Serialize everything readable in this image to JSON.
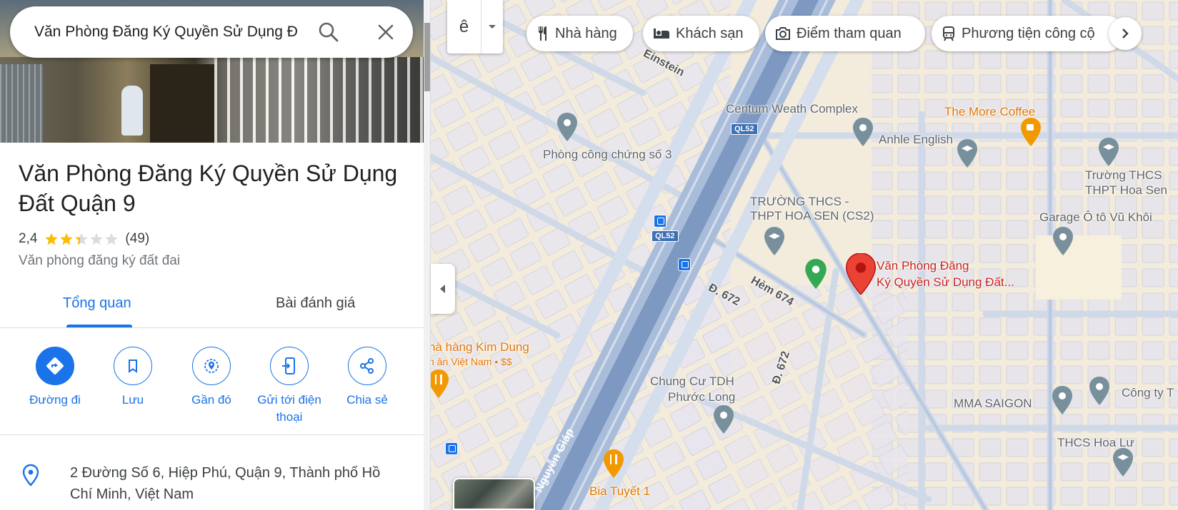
{
  "search": {
    "value": "Văn Phòng Đăng Ký Quyền Sử Dụng Đ"
  },
  "place": {
    "title": "Văn Phòng Đăng Ký Quyền Sử Dụng Đất Quận 9",
    "rating": "2,4",
    "rating_value": 2.4,
    "review_count": "(49)",
    "category": "Văn phòng đăng ký đất đai",
    "address": "2 Đường Số 6, Hiệp Phú, Quận 9, Thành phố Hồ Chí Minh, Việt Nam"
  },
  "tabs": [
    {
      "label": "Tổng quan",
      "active": true
    },
    {
      "label": "Bài đánh giá",
      "active": false
    }
  ],
  "actions": [
    {
      "label": "Đường đi",
      "icon": "directions-icon"
    },
    {
      "label": "Lưu",
      "icon": "bookmark-icon"
    },
    {
      "label": "Gần đó",
      "icon": "nearby-icon"
    },
    {
      "label": "Gửi tới điện thoại",
      "icon": "send-to-phone-icon"
    },
    {
      "label": "Chia sẻ",
      "icon": "share-icon"
    }
  ],
  "map_controls": {
    "language_button": "ê",
    "chips": [
      {
        "label": "Nhà hàng",
        "icon": "restaurant-icon"
      },
      {
        "label": "Khách sạn",
        "icon": "hotel-icon"
      },
      {
        "label": "Điểm tham quan",
        "icon": "camera-icon"
      },
      {
        "label": "Phương tiện công cộ",
        "icon": "transit-icon"
      }
    ]
  },
  "map": {
    "labels": {
      "einstein": "Einstein",
      "centum": "Centum Weath Complex",
      "more_coffee": "The More Coffee",
      "anhle": "Anhle English",
      "cong_chung": "Phòng công chứng số 3",
      "truong_thcs_1": "Trường THCS",
      "truong_thcs_2": "THPT Hoa Sen",
      "hoa_sen_1": "TRƯỜNG THCS -",
      "hoa_sen_2": "THPT HOA SEN (CS2)",
      "garage": "Garage Ô tô Vũ Khôi",
      "selected_1": "Văn Phòng Đăng",
      "selected_2": "Ký Quyền Sử Dụng Đất...",
      "hem674": "Hẻm 674",
      "d672_a": "Đ. 672",
      "d672_b": "Đ. 672",
      "kim_dung_1": "hà hàng Kim Dung",
      "kim_dung_2": "n ăn Việt Nam • $$",
      "chung_cu_1": "Chung Cư TDH",
      "chung_cu_2": "Phước Long",
      "mma": "MMA SAIGON",
      "cong_ty": "Công ty T",
      "hoa_lu": "THCS Hoa Lư",
      "bia_tuyet": "Bia Tuyết 1",
      "nguyen_giap": "Nguyễn Giáp",
      "ql52_a": "QL52",
      "ql52_b": "QL52"
    }
  },
  "colors": {
    "accent": "#1a73e8",
    "selected_pin": "#ea4335",
    "food_pin": "#f29900",
    "poi_pin": "#78909c",
    "park_pin": "#34a853",
    "star": "#fbbc04",
    "highway": "#8eaad2"
  }
}
